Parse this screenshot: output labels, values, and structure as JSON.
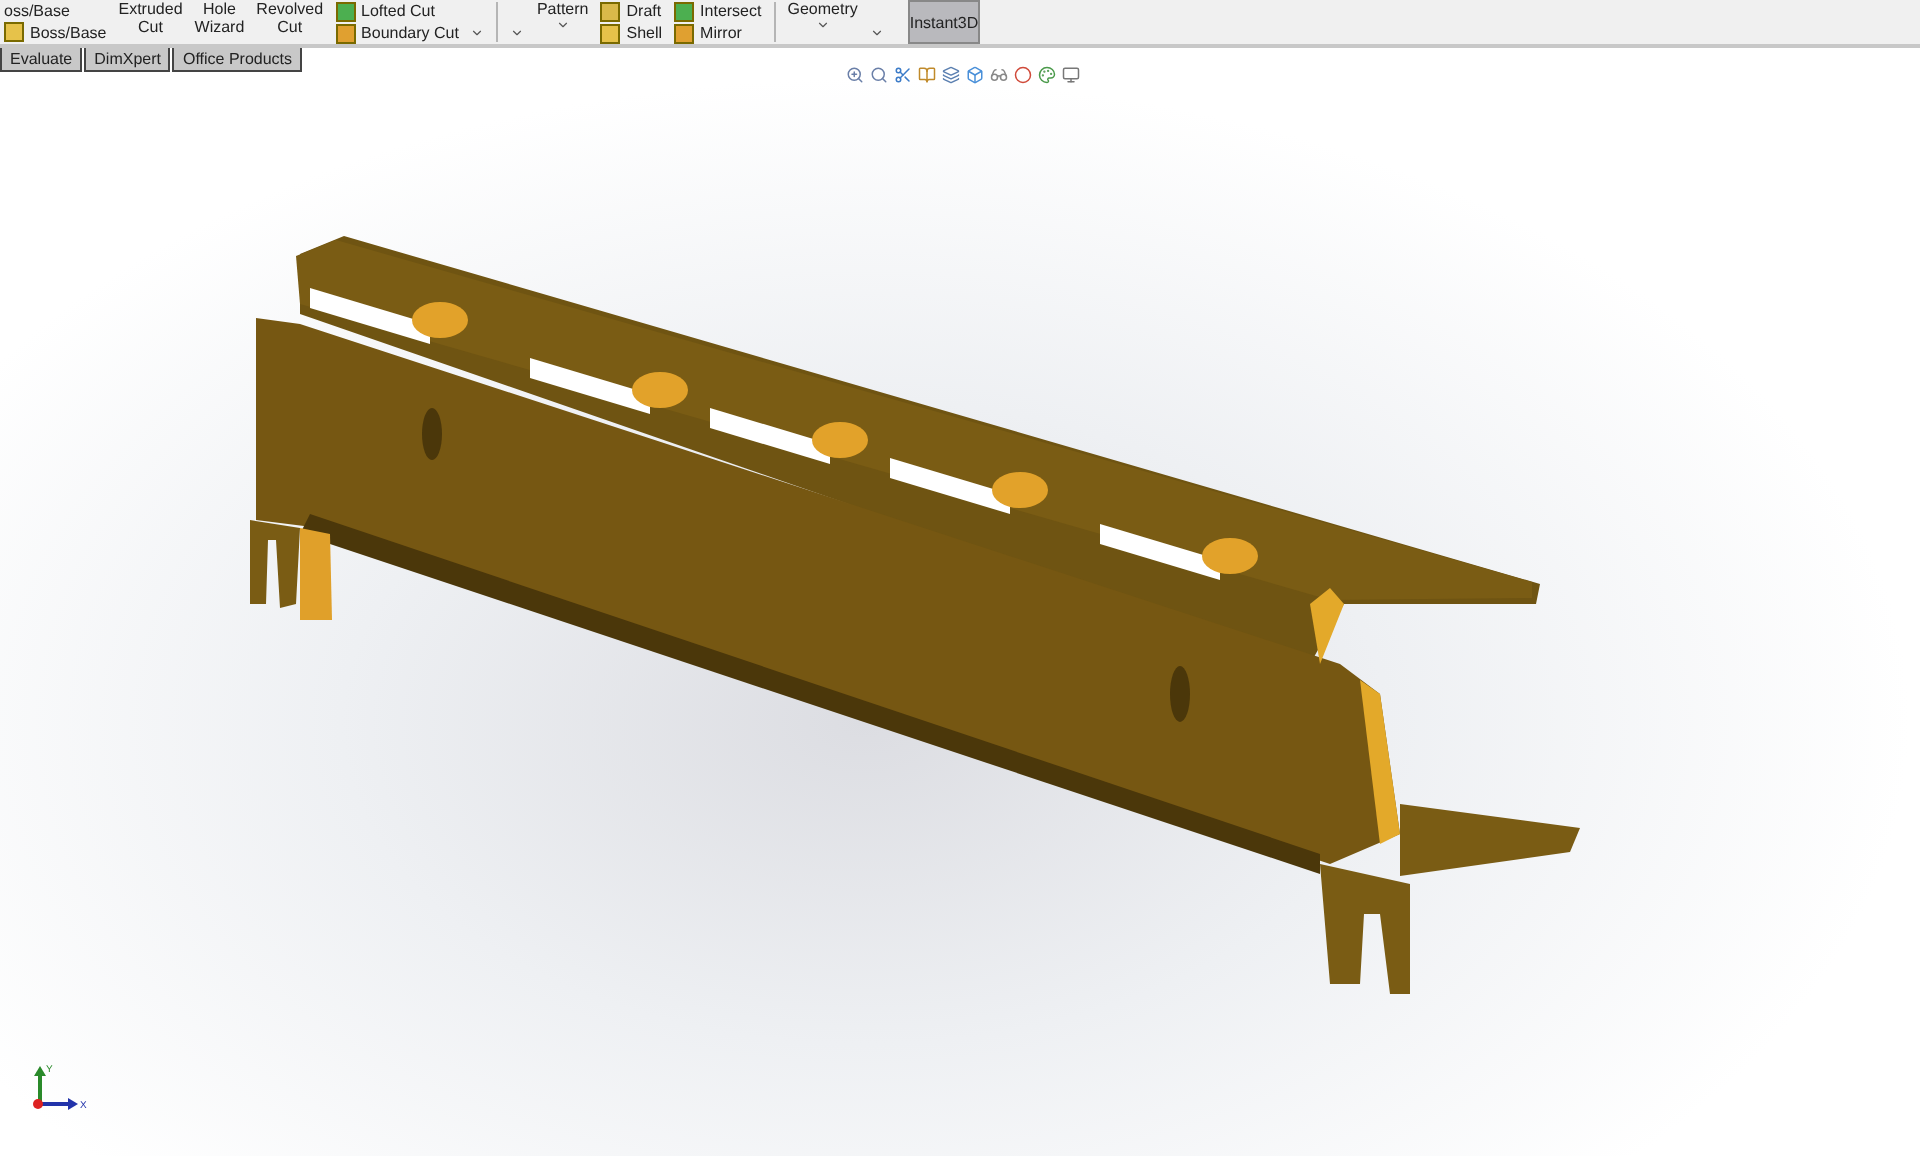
{
  "ribbon": {
    "groups": [
      {
        "kind": "stack",
        "items": [
          {
            "label": "oss/Base",
            "icon": false
          },
          {
            "label": "Boss/Base",
            "icon": true
          }
        ]
      },
      {
        "kind": "column",
        "items": [
          {
            "label": "Extruded"
          },
          {
            "label": "Cut"
          }
        ]
      },
      {
        "kind": "column",
        "items": [
          {
            "label": "Hole"
          },
          {
            "label": "Wizard"
          }
        ]
      },
      {
        "kind": "column",
        "items": [
          {
            "label": "Revolved"
          },
          {
            "label": "Cut"
          }
        ]
      },
      {
        "kind": "stack",
        "items": [
          {
            "label": "Lofted Cut",
            "icon": true
          },
          {
            "label": "Boundary Cut",
            "icon": true
          }
        ]
      },
      {
        "kind": "caret"
      },
      {
        "kind": "separator"
      },
      {
        "kind": "caret"
      },
      {
        "kind": "column",
        "items": [
          {
            "label": "Pattern"
          }
        ],
        "caret": true
      },
      {
        "kind": "stack",
        "items": [
          {
            "label": "Draft",
            "icon": true
          },
          {
            "label": "Shell",
            "icon": true
          }
        ]
      },
      {
        "kind": "stack",
        "items": [
          {
            "label": "Intersect",
            "icon": true
          },
          {
            "label": "Mirror",
            "icon": true
          }
        ]
      },
      {
        "kind": "separator"
      },
      {
        "kind": "column",
        "items": [
          {
            "label": "Geometry"
          }
        ],
        "caret": true
      },
      {
        "kind": "caret"
      },
      {
        "kind": "toggle",
        "label": "Instant3D",
        "on": true
      }
    ]
  },
  "tabs": [
    {
      "label": "Evaluate",
      "selected": false
    },
    {
      "label": "DimXpert",
      "selected": false
    },
    {
      "label": "Office Products",
      "selected": false
    }
  ],
  "triad": {
    "y": "Y",
    "x": "X"
  }
}
